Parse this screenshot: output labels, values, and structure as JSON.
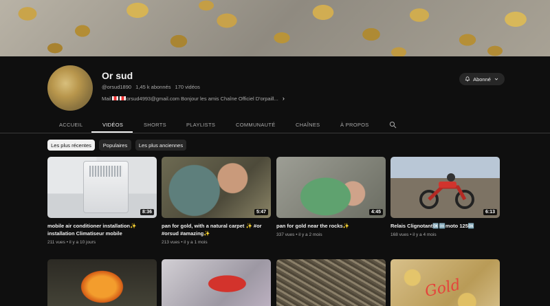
{
  "channel": {
    "name": "Or sud",
    "handle": "@orsud1890",
    "subscribers": "1,45 k abonnés",
    "video_count": "170 vidéos",
    "desc_prefix": "Mail",
    "desc_rest": "orsud4993@gmail.com Bonjour les amis Chaîne Officiel D'orpaill..."
  },
  "subscribe": {
    "label": "Abonné"
  },
  "tabs": [
    "ACCUEIL",
    "VIDÉOS",
    "SHORTS",
    "PLAYLISTS",
    "COMMUNAUTÉ",
    "CHAÎNES",
    "À PROPOS"
  ],
  "active_tab": "VIDÉOS",
  "filters": [
    "Les plus récentes",
    "Populaires",
    "Les plus anciennes"
  ],
  "videos": [
    {
      "title": "mobile air conditioner installation✨ installation Climatiseur mobile",
      "views": "211 vues",
      "age": "il y a 10 jours",
      "duration": "8:36"
    },
    {
      "title": "pan for gold, with a natural carpet ✨ #or #orsud #amazing✨",
      "views": "213 vues",
      "age": "il y a 1 mois",
      "duration": "5:47"
    },
    {
      "title": "pan for gold near the rocks✨",
      "views": "337 vues",
      "age": "il y a 2 mois",
      "duration": "4:45"
    },
    {
      "title": "Relais Clignotant🆗🆒moto 125🆗",
      "views": "168 vues",
      "age": "il y a 4 mois",
      "duration": "6:13"
    },
    {
      "title": "",
      "views": "",
      "age": "",
      "duration": ""
    },
    {
      "title": "",
      "views": "",
      "age": "",
      "duration": ""
    },
    {
      "title": "",
      "views": "",
      "age": "",
      "duration": ""
    },
    {
      "title": "",
      "views": "",
      "age": "",
      "duration": "",
      "thumb_text": "Gold"
    }
  ],
  "colors": {
    "background": "#0f0f0f",
    "text": "#f1f1f1",
    "muted": "#aaaaaa",
    "chip": "#272727"
  }
}
